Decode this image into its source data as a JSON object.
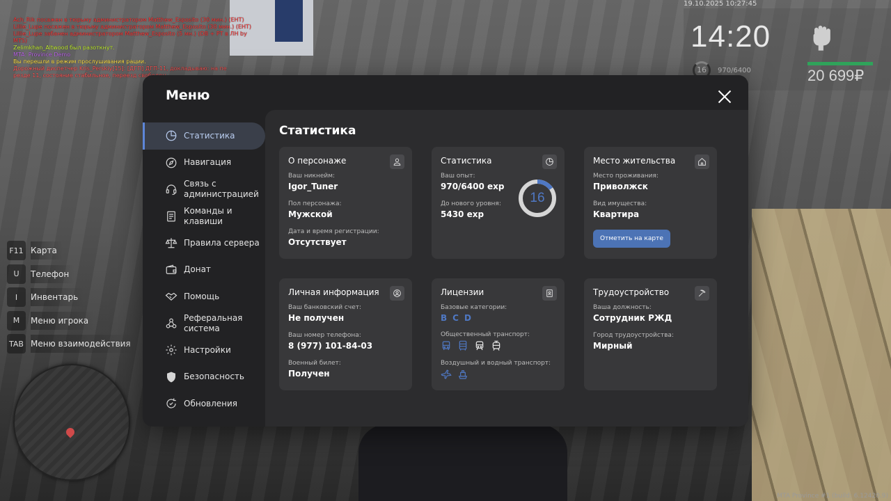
{
  "chat": [
    {
      "text": "Ach_Rik посажен в тюрьму администратором Matthew_Esposito (30 мин.) (ЕНТ)",
      "color": "#ff3b3b"
    },
    {
      "text": "Lillie_Lupe посажен в тюрьму администратором Matthew_Esposito (30 мин.) (ЕНТ)",
      "color": "#ff3b3b"
    },
    {
      "text": "Lillie_Lupe забанен администратором Matthew_Esposito (5 мн.) (DB + PT в ЛН by",
      "color": "#ff3b3b"
    },
    {
      "text": "MTS)",
      "color": "#ff3b3b"
    },
    {
      "text": "Zelimkhan_Altwood был разоткнут.",
      "color": "#c7f23a"
    },
    {
      "text": "MTA: Province Demo",
      "color": "#c36df0"
    },
    {
      "text": "Вы перешли в режим прослушивания рации.",
      "color": "#ffe14a"
    },
    {
      "text": "Дорожный диспетчер Kris_Perskiy[15]: [ДГП] ДГП-11, докладываю: на пе",
      "color": "#ff5a5a"
    },
    {
      "text": "резде 11, состояние стабильное, переезд свободен.",
      "color": "#ff5a5a"
    }
  ],
  "hud": {
    "datetime": "19.10.2025 10:27:45",
    "time": "14:20",
    "level": "16",
    "exp": "970/6400",
    "money": "20 699₽",
    "status_icon": "fist-icon"
  },
  "hotkeys": [
    {
      "key": "F11",
      "label": "Карта"
    },
    {
      "key": "U",
      "label": "Телефон"
    },
    {
      "key": "I",
      "label": "Инвентарь"
    },
    {
      "key": "M",
      "label": "Меню игрока"
    },
    {
      "key": "TAB",
      "label": "Меню взаимодействия"
    }
  ],
  "menu": {
    "title": "Меню",
    "sidebar": [
      {
        "label": "Статистика",
        "icon": "pie-chart-icon",
        "active": true
      },
      {
        "label": "Навигация",
        "icon": "compass-icon"
      },
      {
        "label": "Связь с администрацией",
        "icon": "headset-icon"
      },
      {
        "label": "Команды и клавиши",
        "icon": "document-icon"
      },
      {
        "label": "Правила сервера",
        "icon": "scales-icon"
      },
      {
        "label": "Донат",
        "icon": "wallet-icon"
      },
      {
        "label": "Помощь",
        "icon": "handshake-icon"
      },
      {
        "label": "Реферальная система",
        "icon": "network-icon"
      },
      {
        "label": "Настройки",
        "icon": "gear-icon"
      },
      {
        "label": "Безопасность",
        "icon": "shield-icon"
      },
      {
        "label": "Обновления",
        "icon": "refresh-icon"
      }
    ],
    "content_title": "Статистика",
    "cards": {
      "personal": {
        "title": "О персонаже",
        "icon": "user-icon",
        "nickname_label": "Ваш никнейм:",
        "nickname": "Igor_Tuner",
        "gender_label": "Пол персонажа:",
        "gender": "Мужской",
        "reg_label": "Дата и время регистрации:",
        "reg": "Отсутствует"
      },
      "stats": {
        "title": "Статистика",
        "icon": "pie-chart-icon",
        "exp_label": "Ваш опыт:",
        "exp": "970/6400 exp",
        "next_label": "До нового уровня:",
        "next": "5430 exp",
        "level": "16",
        "progress": 0.152
      },
      "residence": {
        "title": "Место жительства",
        "icon": "home-icon",
        "place_label": "Место проживания:",
        "place": "Приволжск",
        "property_label": "Вид имущества:",
        "property": "Квартира",
        "button": "Отметить на карте"
      },
      "private": {
        "title": "Личная информация",
        "icon": "account-circle-icon",
        "bank_label": "Ваш банковский счет:",
        "bank": "Не получен",
        "phone_label": "Ваш номер телефона:",
        "phone": "8 (977) 101-84-03",
        "military_label": "Военный билет:",
        "military": "Получен"
      },
      "licenses": {
        "title": "Лицензии",
        "icon": "id-card-icon",
        "base_label": "Базовые категории:",
        "categories": [
          "B",
          "C",
          "D"
        ],
        "public_label": "Общественный транспорт:",
        "air_label": "Воздушный и водный транспорт:"
      },
      "job": {
        "title": "Трудоустройство",
        "icon": "pickaxe-icon",
        "position_label": "Ваша должность:",
        "position": "Сотрудник РЖД",
        "city_label": "Город трудоустройства:",
        "city": "Мирный"
      }
    }
  },
  "build": "MTA Province #1 (build: 6.12420.9)"
}
